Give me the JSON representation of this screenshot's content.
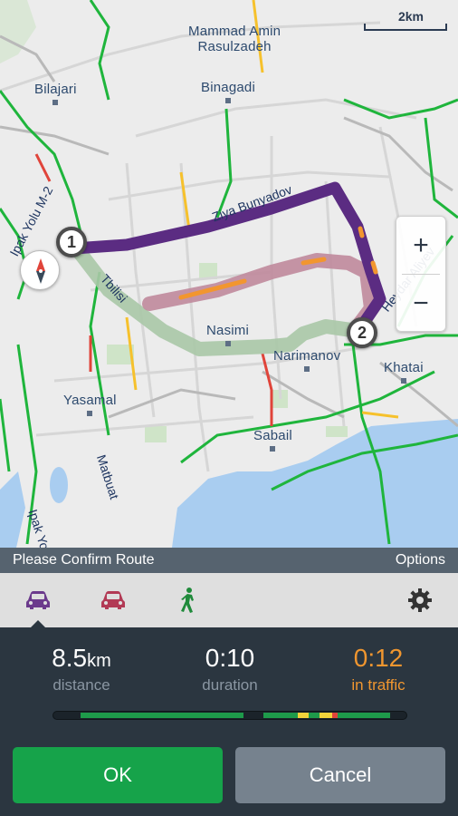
{
  "map": {
    "scale_label": "2km",
    "places": {
      "rasulzadeh": "Mammad Amin\nRasulzadeh",
      "bilajari": "Bilajari",
      "binagadi": "Binagadi",
      "nasimi": "Nasimi",
      "narimanov": "Narimanov",
      "khatai": "Khatai",
      "yasamal": "Yasamal",
      "sabail": "Sabail"
    },
    "roads": {
      "ziya": "Ziya Bunyadov",
      "heydar": "Heydar Aliyev",
      "tbilisi": "Tbilisi",
      "matbuat": "Matbuat",
      "ipak_top": "Ipak Yolu M-2",
      "ipak_bottom": "Ipak Yo"
    },
    "pins": {
      "start": "1",
      "end": "2"
    },
    "zoom": {
      "in": "+",
      "out": "−"
    }
  },
  "confirm_bar": {
    "title": "Please Confirm Route",
    "options": "Options"
  },
  "modes": [
    {
      "name": "car-purple",
      "color": "#6b3a8c"
    },
    {
      "name": "car-pink",
      "color": "#b23a55"
    },
    {
      "name": "walk",
      "color": "#1f8a3a"
    }
  ],
  "stats": {
    "distance": {
      "value": "8.5",
      "unit": "km",
      "label": "distance"
    },
    "duration": {
      "value": "0:10",
      "label": "duration"
    },
    "traffic": {
      "value": "0:12",
      "label": "in traffic"
    }
  },
  "traffic_bar": {
    "colors": {
      "free": "#1e9a4a",
      "slow": "#f2d33a",
      "jam": "#e0443a"
    }
  },
  "buttons": {
    "ok": "OK",
    "cancel": "Cancel"
  }
}
